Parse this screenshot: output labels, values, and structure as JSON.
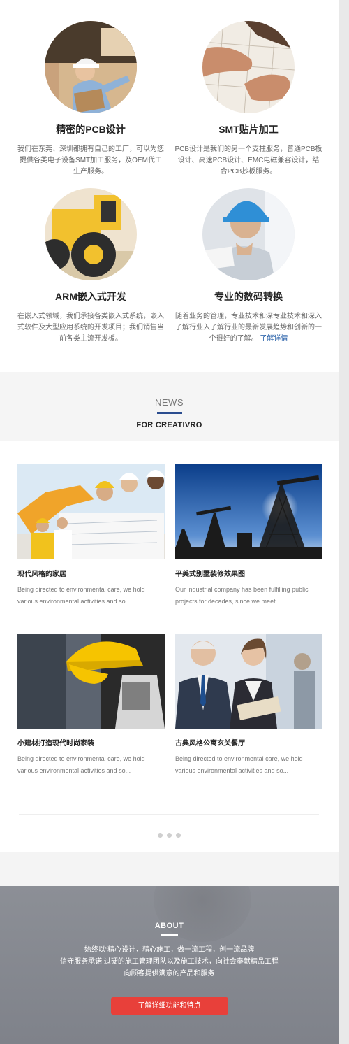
{
  "services": [
    {
      "title": "精密的PCB设计",
      "desc": "我们在东莞、深圳都拥有自己的工厂，可以为您提供各类电子设备SMT加工服务，及OEM代工生产服务。",
      "link": ""
    },
    {
      "title": "SMT贴片加工",
      "desc": "PCB设计是我们的另一个支柱服务，普通PCB板设计、高速PCB设计、EMC电磁兼容设计，结合PCB抄板服务。",
      "link": ""
    },
    {
      "title": "ARM嵌入式开发",
      "desc": "在嵌入式领域，我们承接各类嵌入式系统，嵌入式软件及大型应用系统的开发项目；我们销售当前各类主流开发板。",
      "link": ""
    },
    {
      "title": "专业的数码转换",
      "desc": "随着业务的管理，专业技术和深专业技术和深入了解行业入了解行业的最新发展趋势和创新的一个很好的了解。",
      "link": "了解详情"
    }
  ],
  "news": {
    "heading": "NEWS",
    "subheading": "FOR CREATIVRO",
    "items": [
      {
        "title": "现代风格的家居",
        "desc": "Being directed to environmental care, we hold various environmental activities and so..."
      },
      {
        "title": "平美式别墅装修效果图",
        "desc": "Our industrial company has been fulfilling public projects for decades, since we meet..."
      },
      {
        "title": "小建材打造现代时尚家装",
        "desc": "Being directed to environmental care, we hold various environmental activities and so..."
      },
      {
        "title": "古典风格公寓玄关餐厅",
        "desc": "Being directed to environmental care, we hold various environmental activities and so..."
      }
    ]
  },
  "about": {
    "heading": "ABOUT",
    "line1": "始终以“精心设计，精心施工，做一流工程，创一流品牌",
    "line2": "信守服务承诺,过硬的施工管理团队以及施工技术，向社会奉献精品工程",
    "line3": "向顾客提供满意的产品和服务",
    "button": "了解详细功能和特点"
  },
  "colors": {
    "accent_blue": "#2b4d8f",
    "button_red": "#e8403a",
    "link_blue": "#1f5aa5"
  }
}
